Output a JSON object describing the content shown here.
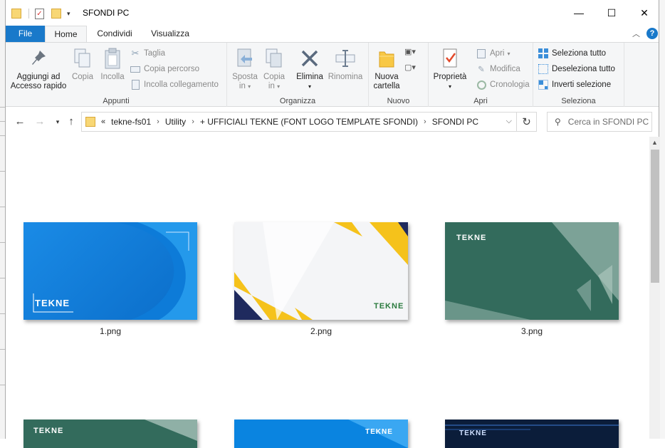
{
  "window": {
    "title": "SFONDI PC",
    "minimize": "—",
    "maximize": "☐",
    "close": "✕"
  },
  "tabs": {
    "file": "File",
    "home": "Home",
    "share": "Condividi",
    "view": "Visualizza"
  },
  "ribbon": {
    "appunti": {
      "label": "Appunti",
      "pin_line1": "Aggiungi ad",
      "pin_line2": "Accesso rapido",
      "copy": "Copia",
      "paste": "Incolla",
      "cut": "Taglia",
      "copy_path": "Copia percorso",
      "paste_link": "Incolla collegamento"
    },
    "organizza": {
      "label": "Organizza",
      "move_line1": "Sposta",
      "move_line2": "in",
      "copyto_line1": "Copia",
      "copyto_line2": "in",
      "delete": "Elimina",
      "rename": "Rinomina"
    },
    "nuovo": {
      "label": "Nuovo",
      "newfolder_line1": "Nuova",
      "newfolder_line2": "cartella"
    },
    "apri": {
      "label": "Apri",
      "properties": "Proprietà",
      "open": "Apri",
      "edit": "Modifica",
      "history": "Cronologia"
    },
    "seleziona": {
      "label": "Seleziona",
      "select_all": "Seleziona tutto",
      "deselect_all": "Deseleziona tutto",
      "invert": "Inverti selezione"
    }
  },
  "address": {
    "overflow": "«",
    "crumbs": [
      "tekne-fs01",
      "Utility",
      "+ UFFICIALI TEKNE (FONT LOGO TEMPLATE SFONDI)",
      "SFONDI PC"
    ],
    "search_placeholder": "Cerca in SFONDI PC"
  },
  "files": [
    {
      "name": "1.png",
      "logo": "TEKNE"
    },
    {
      "name": "2.png",
      "logo": "TEKNE"
    },
    {
      "name": "3.png",
      "logo": "TEKNE"
    },
    {
      "name": "",
      "logo": "TEKNE"
    },
    {
      "name": "",
      "logo": "TEKNE"
    },
    {
      "name": "",
      "logo": "TEKNE"
    }
  ],
  "colors": {
    "accent": "#1979ca",
    "thumb1": "#0a84e0",
    "thumb2_accent": "#f5c21b",
    "thumb3": "#336b5c"
  }
}
